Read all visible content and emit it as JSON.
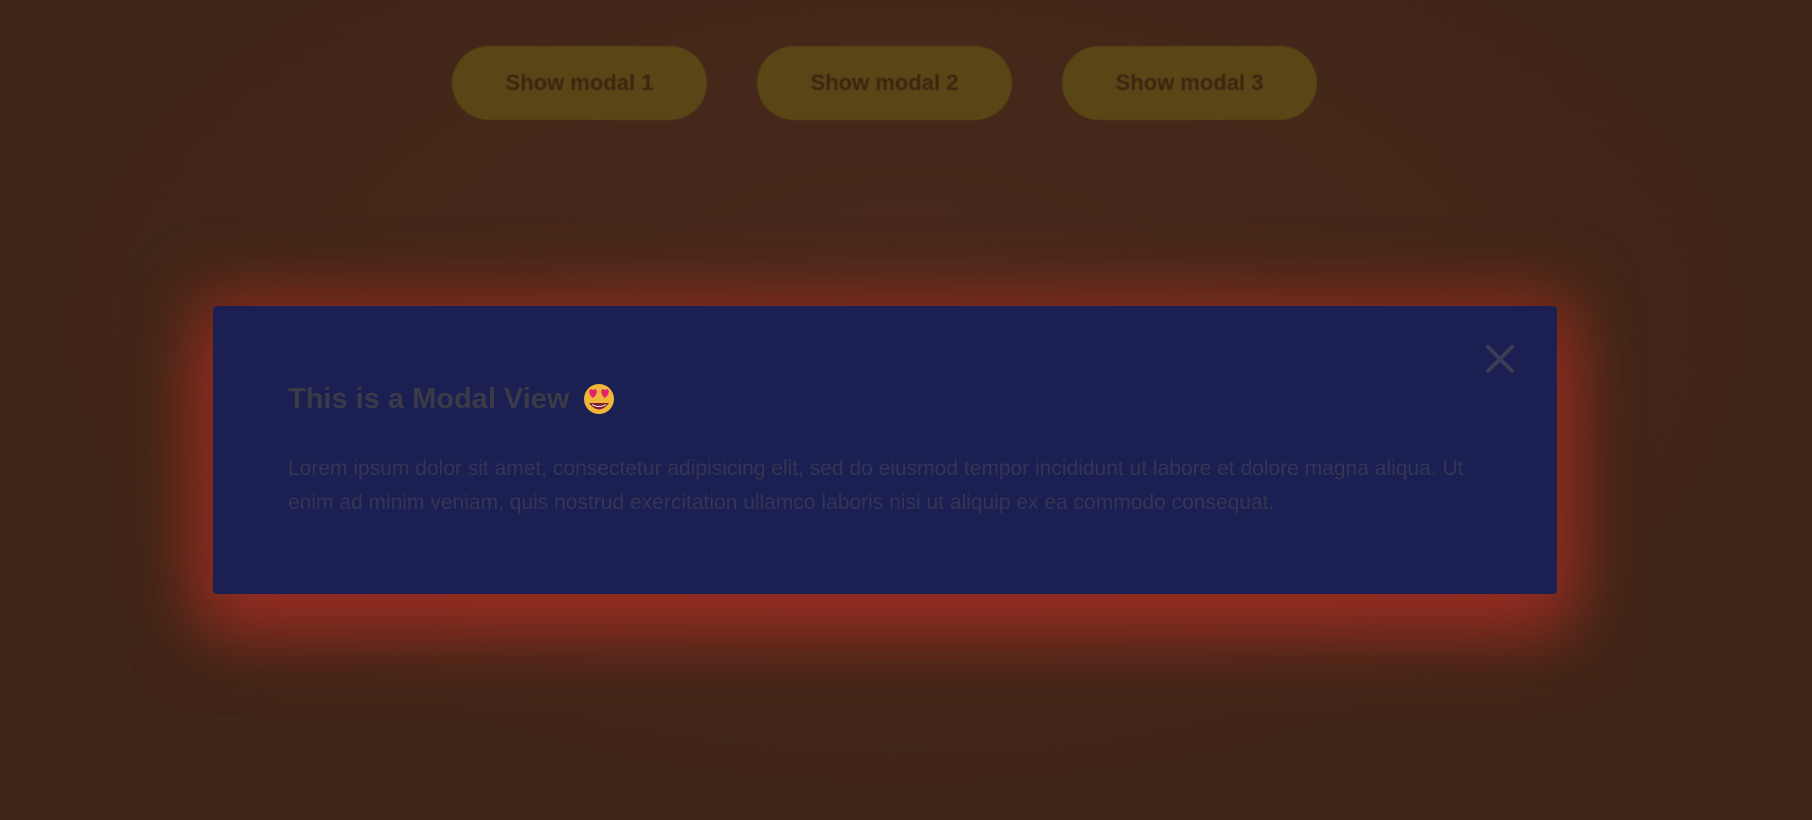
{
  "buttons": [
    {
      "label": "Show modal 1"
    },
    {
      "label": "Show modal 2"
    },
    {
      "label": "Show modal 3"
    }
  ],
  "modal": {
    "title": "This is a Modal View",
    "title_emoji": "star-struck-heart-eyes-emoji",
    "body": "Lorem ipsum dolor sit amet, consectetur adipisicing elit, sed do eiusmod tempor incididunt ut labore et dolore magna aliqua. Ut enim ad minim veniam, quis nostrud exercitation ullamco laboris nisi ut aliquip ex ea commodo consequat.",
    "close_icon": "close-icon"
  },
  "colors": {
    "background": "#452919",
    "pill_button": "#5e4a18",
    "modal_background": "#1b1f52",
    "modal_glow": "#a02d23"
  }
}
